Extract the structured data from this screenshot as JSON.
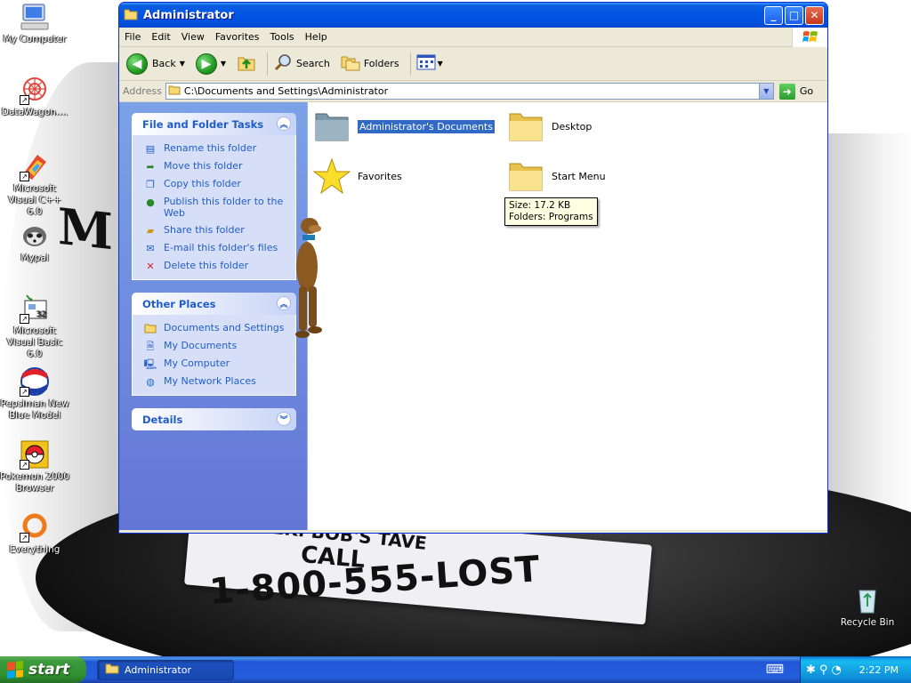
{
  "desktop": {
    "wallpaper": {
      "letter": "M",
      "tag_line1": "WEEK: BOB'S TAVE",
      "tag_line2": "CALL",
      "tag_line3": "1-800-555-LOST"
    },
    "icons": [
      {
        "label": "My Computer",
        "icon": "my-computer-icon"
      },
      {
        "label": "DataWagon....",
        "icon": "datawagon-icon"
      },
      {
        "label": "Microsoft Visual C++ 6.0",
        "icon": "visual-cpp-icon"
      },
      {
        "label": "Mypal",
        "icon": "mypal-icon"
      },
      {
        "label": "Microsoft Visual Basic 6.0",
        "icon": "visual-basic-icon"
      },
      {
        "label": "Pepsiman New Blue Model",
        "icon": "pepsi-icon"
      },
      {
        "label": "Pokemon 2000 Browser",
        "icon": "pokeball-icon"
      },
      {
        "label": "Everything",
        "icon": "everything-icon"
      },
      {
        "label": "Recycle Bin",
        "icon": "recycle-bin-icon"
      }
    ]
  },
  "window": {
    "title": "Administrator",
    "menu": [
      "File",
      "Edit",
      "View",
      "Favorites",
      "Tools",
      "Help"
    ],
    "toolbar": {
      "back": "Back",
      "search": "Search",
      "folders": "Folders"
    },
    "address": {
      "label": "Address",
      "value": "C:\\Documents and Settings\\Administrator",
      "go": "Go"
    },
    "tasks_panel": {
      "title": "File and Folder Tasks",
      "items": [
        "Rename this folder",
        "Move this folder",
        "Copy this folder",
        "Publish this folder to the Web",
        "Share this folder",
        "E-mail this folder's files",
        "Delete this folder"
      ]
    },
    "places_panel": {
      "title": "Other Places",
      "items": [
        "Documents and Settings",
        "My Documents",
        "My Computer",
        "My Network Places"
      ]
    },
    "details_panel": {
      "title": "Details"
    },
    "files": [
      {
        "name": "Administrator's Documents",
        "icon": "my-documents-folder-icon",
        "selected": true
      },
      {
        "name": "Desktop",
        "icon": "folder-icon",
        "selected": false
      },
      {
        "name": "Favorites",
        "icon": "star-icon",
        "selected": false
      },
      {
        "name": "Start Menu",
        "icon": "folder-icon",
        "selected": false
      }
    ],
    "tooltip": {
      "line1": "Size: 17.2 KB",
      "line2": "Folders: Programs"
    }
  },
  "taskbar": {
    "start_label": "start",
    "task_button": "Administrator",
    "clock": "2:22 PM"
  },
  "colors": {
    "titlebar": "#0054e3",
    "taskpane_link": "#215dc6",
    "selection": "#316ac5",
    "start_green": "#309130"
  }
}
